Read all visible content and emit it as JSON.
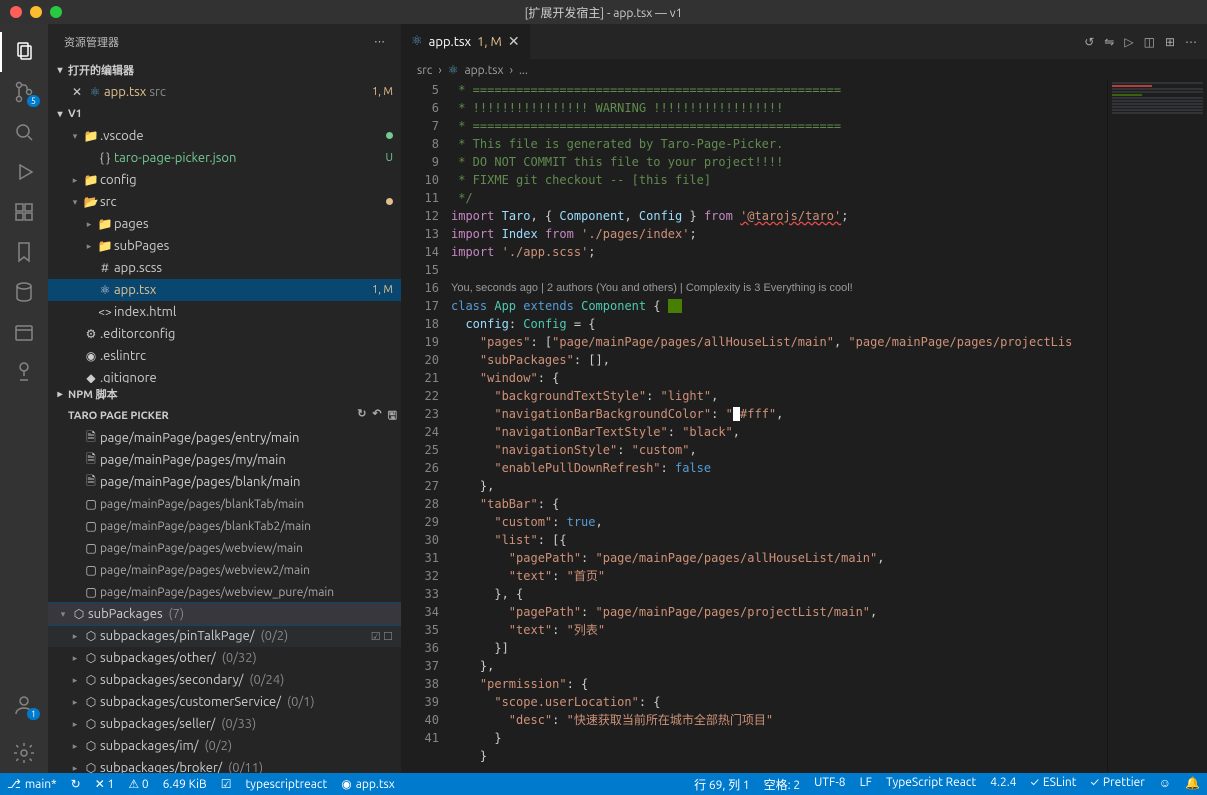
{
  "window": {
    "title": "[扩展开发宿主] - app.tsx — v1"
  },
  "sidebar": {
    "title": "资源管理器",
    "open_editors": {
      "label": "打开的编辑器",
      "items": [
        {
          "name": "app.tsx",
          "path": "src",
          "status": "1, M"
        }
      ]
    },
    "project": {
      "name": "V1",
      "tree": [
        {
          "icon": "folder",
          "name": ".vscode",
          "chev": "down",
          "indent": 1,
          "mod": "green-dot"
        },
        {
          "icon": "json",
          "name": "taro-page-picker.json",
          "indent": 2,
          "status": "U",
          "color": "green"
        },
        {
          "icon": "folder",
          "name": "config",
          "chev": "right",
          "indent": 1
        },
        {
          "icon": "folder-orange",
          "name": "src",
          "chev": "down",
          "indent": 1,
          "mod": "orange-dot"
        },
        {
          "icon": "folder",
          "name": "pages",
          "chev": "right",
          "indent": 2
        },
        {
          "icon": "folder",
          "name": "subPages",
          "chev": "right",
          "indent": 2
        },
        {
          "icon": "scss",
          "name": "app.scss",
          "indent": 2
        },
        {
          "icon": "react",
          "name": "app.tsx",
          "indent": 2,
          "status": "1, M",
          "color": "orange",
          "selected": true
        },
        {
          "icon": "html",
          "name": "index.html",
          "indent": 2
        },
        {
          "icon": "config",
          "name": ".editorconfig",
          "indent": 1
        },
        {
          "icon": "eslint",
          "name": ".eslintrc",
          "indent": 1
        },
        {
          "icon": "git",
          "name": ".gitignore",
          "indent": 1
        }
      ]
    },
    "npm": {
      "label": "NPM 脚本"
    },
    "picker": {
      "label": "TARO PAGE PICKER",
      "pages": [
        {
          "t": "page/mainPage/pages/entry/main",
          "big": true,
          "icon": "file"
        },
        {
          "t": "page/mainPage/pages/my/main",
          "big": true,
          "icon": "file"
        },
        {
          "t": "page/mainPage/pages/blank/main",
          "big": true,
          "icon": "file"
        },
        {
          "t": "page/mainPage/pages/blankTab/main",
          "icon": "file-o"
        },
        {
          "t": "page/mainPage/pages/blankTab2/main",
          "icon": "file-o"
        },
        {
          "t": "page/mainPage/pages/webview/main",
          "icon": "file-o"
        },
        {
          "t": "page/mainPage/pages/webview2/main",
          "icon": "file-o"
        },
        {
          "t": "page/mainPage/pages/webview_pure/main",
          "icon": "file-o"
        }
      ],
      "subpkg_label": "subPackages",
      "subpkg_count": "(7)",
      "subpkgs": [
        {
          "name": "subpackages/pinTalkPage/",
          "count": "(0/2)",
          "hover": true
        },
        {
          "name": "subpackages/other/",
          "count": "(0/32)"
        },
        {
          "name": "subpackages/secondary/",
          "count": "(0/24)"
        },
        {
          "name": "subpackages/customerService/",
          "count": "(0/1)"
        },
        {
          "name": "subpackages/seller/",
          "count": "(0/33)"
        },
        {
          "name": "subpackages/im/",
          "count": "(0/2)"
        },
        {
          "name": "subpackages/broker/",
          "count": "(0/11)"
        }
      ]
    }
  },
  "editor": {
    "tab": {
      "name": "app.tsx",
      "status": "1, M"
    },
    "breadcrumb": [
      "src",
      "app.tsx",
      "..."
    ],
    "codelens": "You, seconds ago | 2 authors (You and others) | Complexity is 3 Everything is cool!",
    "lines_start": 5,
    "code": [
      {
        "n": 5,
        "html": " <span class='tok-c'>* ===================================================</span>"
      },
      {
        "n": 6,
        "html": " <span class='tok-c'>* !!!!!!!!!!!!!!!! WARNING !!!!!!!!!!!!!!!!!!</span>"
      },
      {
        "n": 7,
        "html": " <span class='tok-c'>* ===================================================</span>"
      },
      {
        "n": 8,
        "html": " <span class='tok-c'>* This file is generated by Taro-Page-Picker.</span>"
      },
      {
        "n": 9,
        "html": " <span class='tok-c'>* DO NOT COMMIT this file to your project!!!!</span>"
      },
      {
        "n": 10,
        "html": " <span class='tok-c'>* FIXME git checkout -- [this file]</span>"
      },
      {
        "n": 11,
        "html": " <span class='tok-c'>*/</span>"
      },
      {
        "n": 12,
        "html": "<span class='tok-k2'>import</span> <span class='tok-p'>Taro</span>, { <span class='tok-p'>Component</span>, <span class='tok-p'>Config</span> } <span class='tok-k2'>from</span> <span class='tok-s sq-underline'>'@tarojs/taro'</span>;"
      },
      {
        "n": 13,
        "html": "<span class='tok-k2'>import</span> <span class='tok-p'>Index</span> <span class='tok-k2'>from</span> <span class='tok-s'>'./pages/index'</span>;"
      },
      {
        "n": 14,
        "html": "<span class='tok-k2'>import</span> <span class='tok-s'>'./app.scss'</span>;"
      },
      {
        "n": 15,
        "html": ""
      },
      {
        "n": 16,
        "html": "<span class='tok-k'>class</span> <span class='tok-t'>App</span> <span class='tok-k'>extends</span> <span class='tok-t'>Component</span> { <span style='background:#487e02;'>&nbsp;&nbsp;</span>",
        "codelens_above": true
      },
      {
        "n": 17,
        "html": "  <span class='tok-p'>config</span>: <span class='tok-t'>Config</span> = {"
      },
      {
        "n": 18,
        "html": "    <span class='tok-s'>\"pages\"</span>: [<span class='tok-s'>\"page/mainPage/pages/allHouseList/main\"</span>, <span class='tok-s'>\"page/mainPage/pages/projectLis</span>"
      },
      {
        "n": 19,
        "html": "    <span class='tok-s'>\"subPackages\"</span>: [],"
      },
      {
        "n": 20,
        "html": "    <span class='tok-s'>\"window\"</span>: {"
      },
      {
        "n": 21,
        "html": "      <span class='tok-s'>\"backgroundTextStyle\"</span>: <span class='tok-s'>\"light\"</span>,"
      },
      {
        "n": 22,
        "html": "      <span class='tok-s'>\"navigationBarBackgroundColor\"</span>: <span class='tok-s'>\"<span style='background:#fff;'>&nbsp;</span>#fff\"</span>,"
      },
      {
        "n": 23,
        "html": "      <span class='tok-s'>\"navigationBarTextStyle\"</span>: <span class='tok-s'>\"black\"</span>,"
      },
      {
        "n": 24,
        "html": "      <span class='tok-s'>\"navigationStyle\"</span>: <span class='tok-s'>\"custom\"</span>,"
      },
      {
        "n": 25,
        "html": "      <span class='tok-s'>\"enablePullDownRefresh\"</span>: <span class='tok-k'>false</span>"
      },
      {
        "n": 26,
        "html": "    },"
      },
      {
        "n": 27,
        "html": "    <span class='tok-s'>\"tabBar\"</span>: {"
      },
      {
        "n": 28,
        "html": "      <span class='tok-s'>\"custom\"</span>: <span class='tok-k'>true</span>,"
      },
      {
        "n": 29,
        "html": "      <span class='tok-s'>\"list\"</span>: [{"
      },
      {
        "n": 30,
        "html": "        <span class='tok-s'>\"pagePath\"</span>: <span class='tok-s'>\"page/mainPage/pages/allHouseList/main\"</span>,"
      },
      {
        "n": 31,
        "html": "        <span class='tok-s'>\"text\"</span>: <span class='tok-s'>\"首页\"</span>"
      },
      {
        "n": 32,
        "html": "      }, {"
      },
      {
        "n": 33,
        "html": "        <span class='tok-s'>\"pagePath\"</span>: <span class='tok-s'>\"page/mainPage/pages/projectList/main\"</span>,"
      },
      {
        "n": 34,
        "html": "        <span class='tok-s'>\"text\"</span>: <span class='tok-s'>\"列表\"</span>"
      },
      {
        "n": 35,
        "html": "      }]"
      },
      {
        "n": 36,
        "html": "    },"
      },
      {
        "n": 37,
        "html": "    <span class='tok-s'>\"permission\"</span>: {"
      },
      {
        "n": 38,
        "html": "      <span class='tok-s'>\"scope.userLocation\"</span>: {"
      },
      {
        "n": 39,
        "html": "        <span class='tok-s'>\"desc\"</span>: <span class='tok-s'>\"快速获取当前所在城市全部热门项目\"</span>"
      },
      {
        "n": 40,
        "html": "      }"
      },
      {
        "n": 41,
        "html": "    }"
      }
    ]
  },
  "status": {
    "branch": "main*",
    "sync": "↻",
    "errors": "✕ 1",
    "warnings": "⚠ 0",
    "size": "6.49 KiB",
    "cursor": "行 69, 列 1",
    "spaces": "空格: 2",
    "encoding": "UTF-8",
    "eol": "LF",
    "lang": "TypeScript React",
    "version": "4.2.4",
    "eslint": "ESLint",
    "prettier": "Prettier",
    "file": "app.tsx",
    "lang2": "typescriptreact"
  },
  "colors": {
    "accent": "#007acc"
  }
}
